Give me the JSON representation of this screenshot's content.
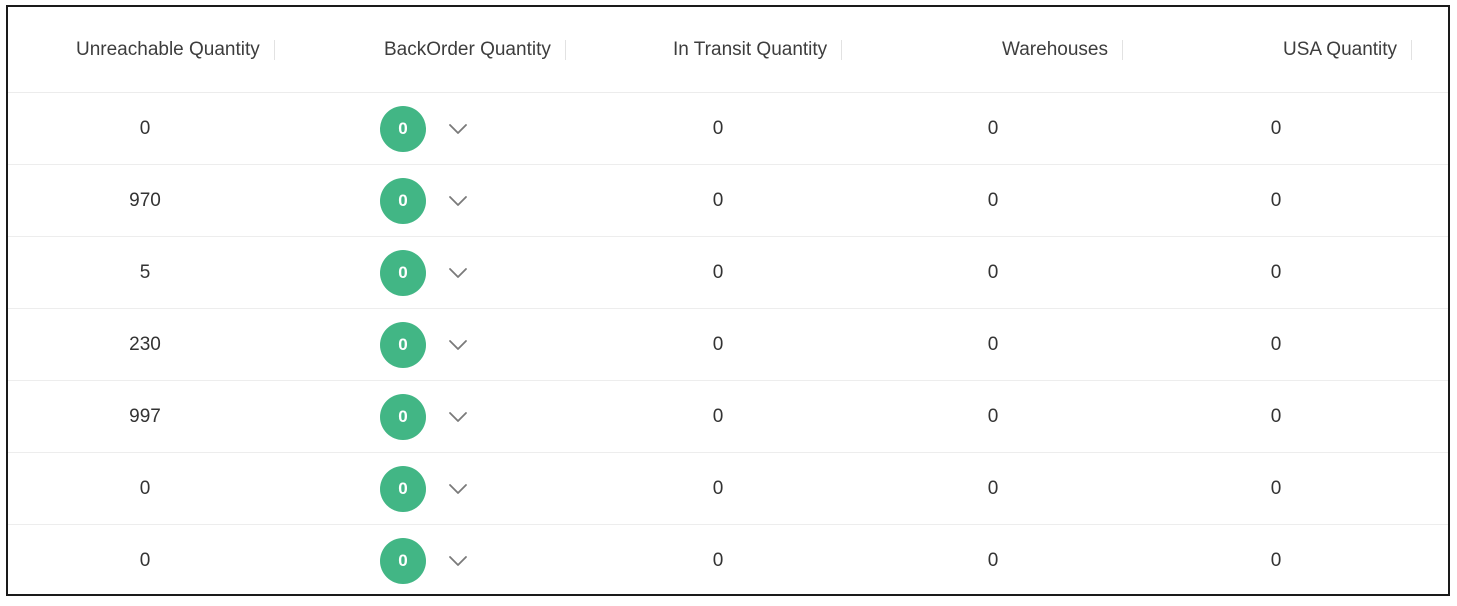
{
  "colors": {
    "badge": "#42b685",
    "chevron": "#7a7a7a"
  },
  "table": {
    "headers": [
      "Unreachable Quantity",
      "BackOrder Quantity",
      "In Transit Quantity",
      "Warehouses",
      "USA Quantity"
    ],
    "rows": [
      {
        "unreachable": "0",
        "backorder": "0",
        "in_transit": "0",
        "warehouses": "0",
        "usa": "0"
      },
      {
        "unreachable": "970",
        "backorder": "0",
        "in_transit": "0",
        "warehouses": "0",
        "usa": "0"
      },
      {
        "unreachable": "5",
        "backorder": "0",
        "in_transit": "0",
        "warehouses": "0",
        "usa": "0"
      },
      {
        "unreachable": "230",
        "backorder": "0",
        "in_transit": "0",
        "warehouses": "0",
        "usa": "0"
      },
      {
        "unreachable": "997",
        "backorder": "0",
        "in_transit": "0",
        "warehouses": "0",
        "usa": "0"
      },
      {
        "unreachable": "0",
        "backorder": "0",
        "in_transit": "0",
        "warehouses": "0",
        "usa": "0"
      },
      {
        "unreachable": "0",
        "backorder": "0",
        "in_transit": "0",
        "warehouses": "0",
        "usa": "0"
      }
    ],
    "expand_icon": "chevron-down-icon"
  }
}
